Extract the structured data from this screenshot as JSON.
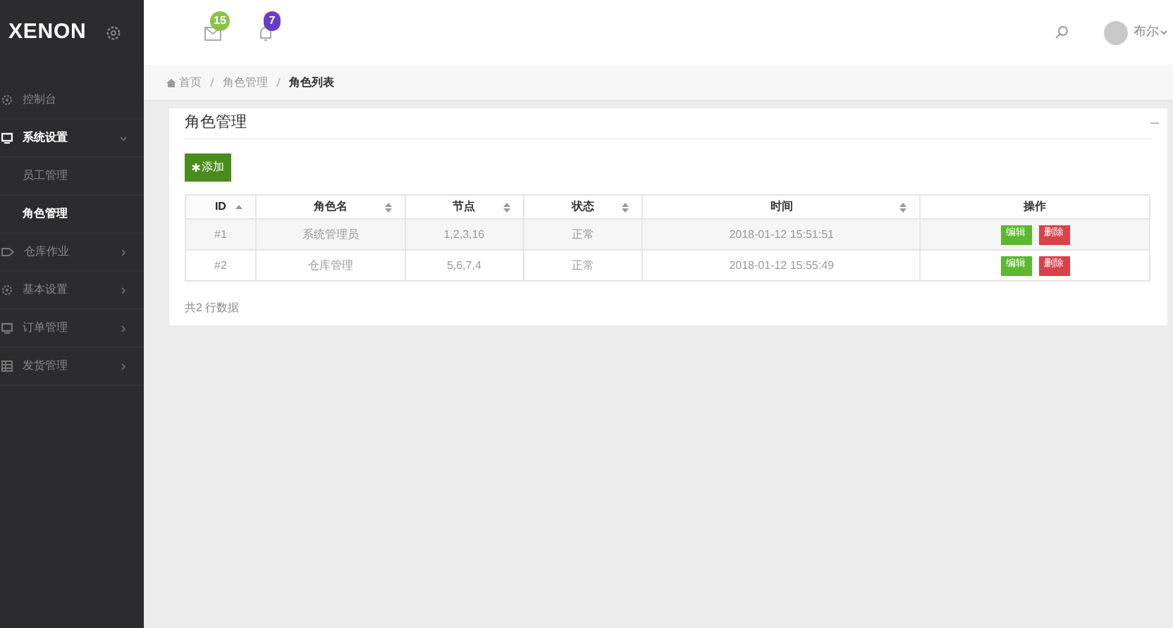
{
  "logo": "XENON",
  "header": {
    "mail_badge": "15",
    "bell_badge": "7",
    "user": "布尔"
  },
  "sidebar": {
    "items": [
      {
        "label": "控制台",
        "selected": false
      },
      {
        "label": "系统设置",
        "selected": false,
        "expanded": true,
        "children": [
          {
            "label": "员工管理",
            "selected": false
          },
          {
            "label": "角色管理",
            "selected": true
          }
        ]
      },
      {
        "label": "仓库作业",
        "selected": false,
        "expanded": false
      },
      {
        "label": "基本设置",
        "selected": false,
        "expanded": false
      },
      {
        "label": "订单管理",
        "selected": false,
        "expanded": false
      },
      {
        "label": "发货管理",
        "selected": false,
        "expanded": false
      }
    ]
  },
  "breadcrumb": [
    "首页",
    "角色管理",
    "角色列表"
  ],
  "panel": {
    "title": "角色管理",
    "add_button": "添加",
    "table": {
      "columns": [
        {
          "label": "ID",
          "sortable": true,
          "selected": true
        },
        {
          "label": "角色名",
          "sortable": true,
          "selected": false
        },
        {
          "label": "节点",
          "sortable": true,
          "selected": false
        },
        {
          "label": "状态",
          "sortable": true,
          "selected": false
        },
        {
          "label": "时间",
          "sortable": true,
          "selected": false
        },
        {
          "label": "操作",
          "sortable": false,
          "selected": false
        }
      ],
      "rows": [
        {
          "id": "#1",
          "name": "系统管理员",
          "nodes": "1,2,3,16",
          "status": "正常",
          "time": "2018-01-12 15:51:51",
          "edit": "编辑",
          "delete": "删除"
        },
        {
          "id": "#2",
          "name": "仓库管理",
          "nodes": "5,6,7,4",
          "status": "正常",
          "time": "2018-01-12 15:55:49",
          "edit": "编辑",
          "delete": "删除"
        }
      ]
    },
    "footer": "共2 行数据"
  }
}
